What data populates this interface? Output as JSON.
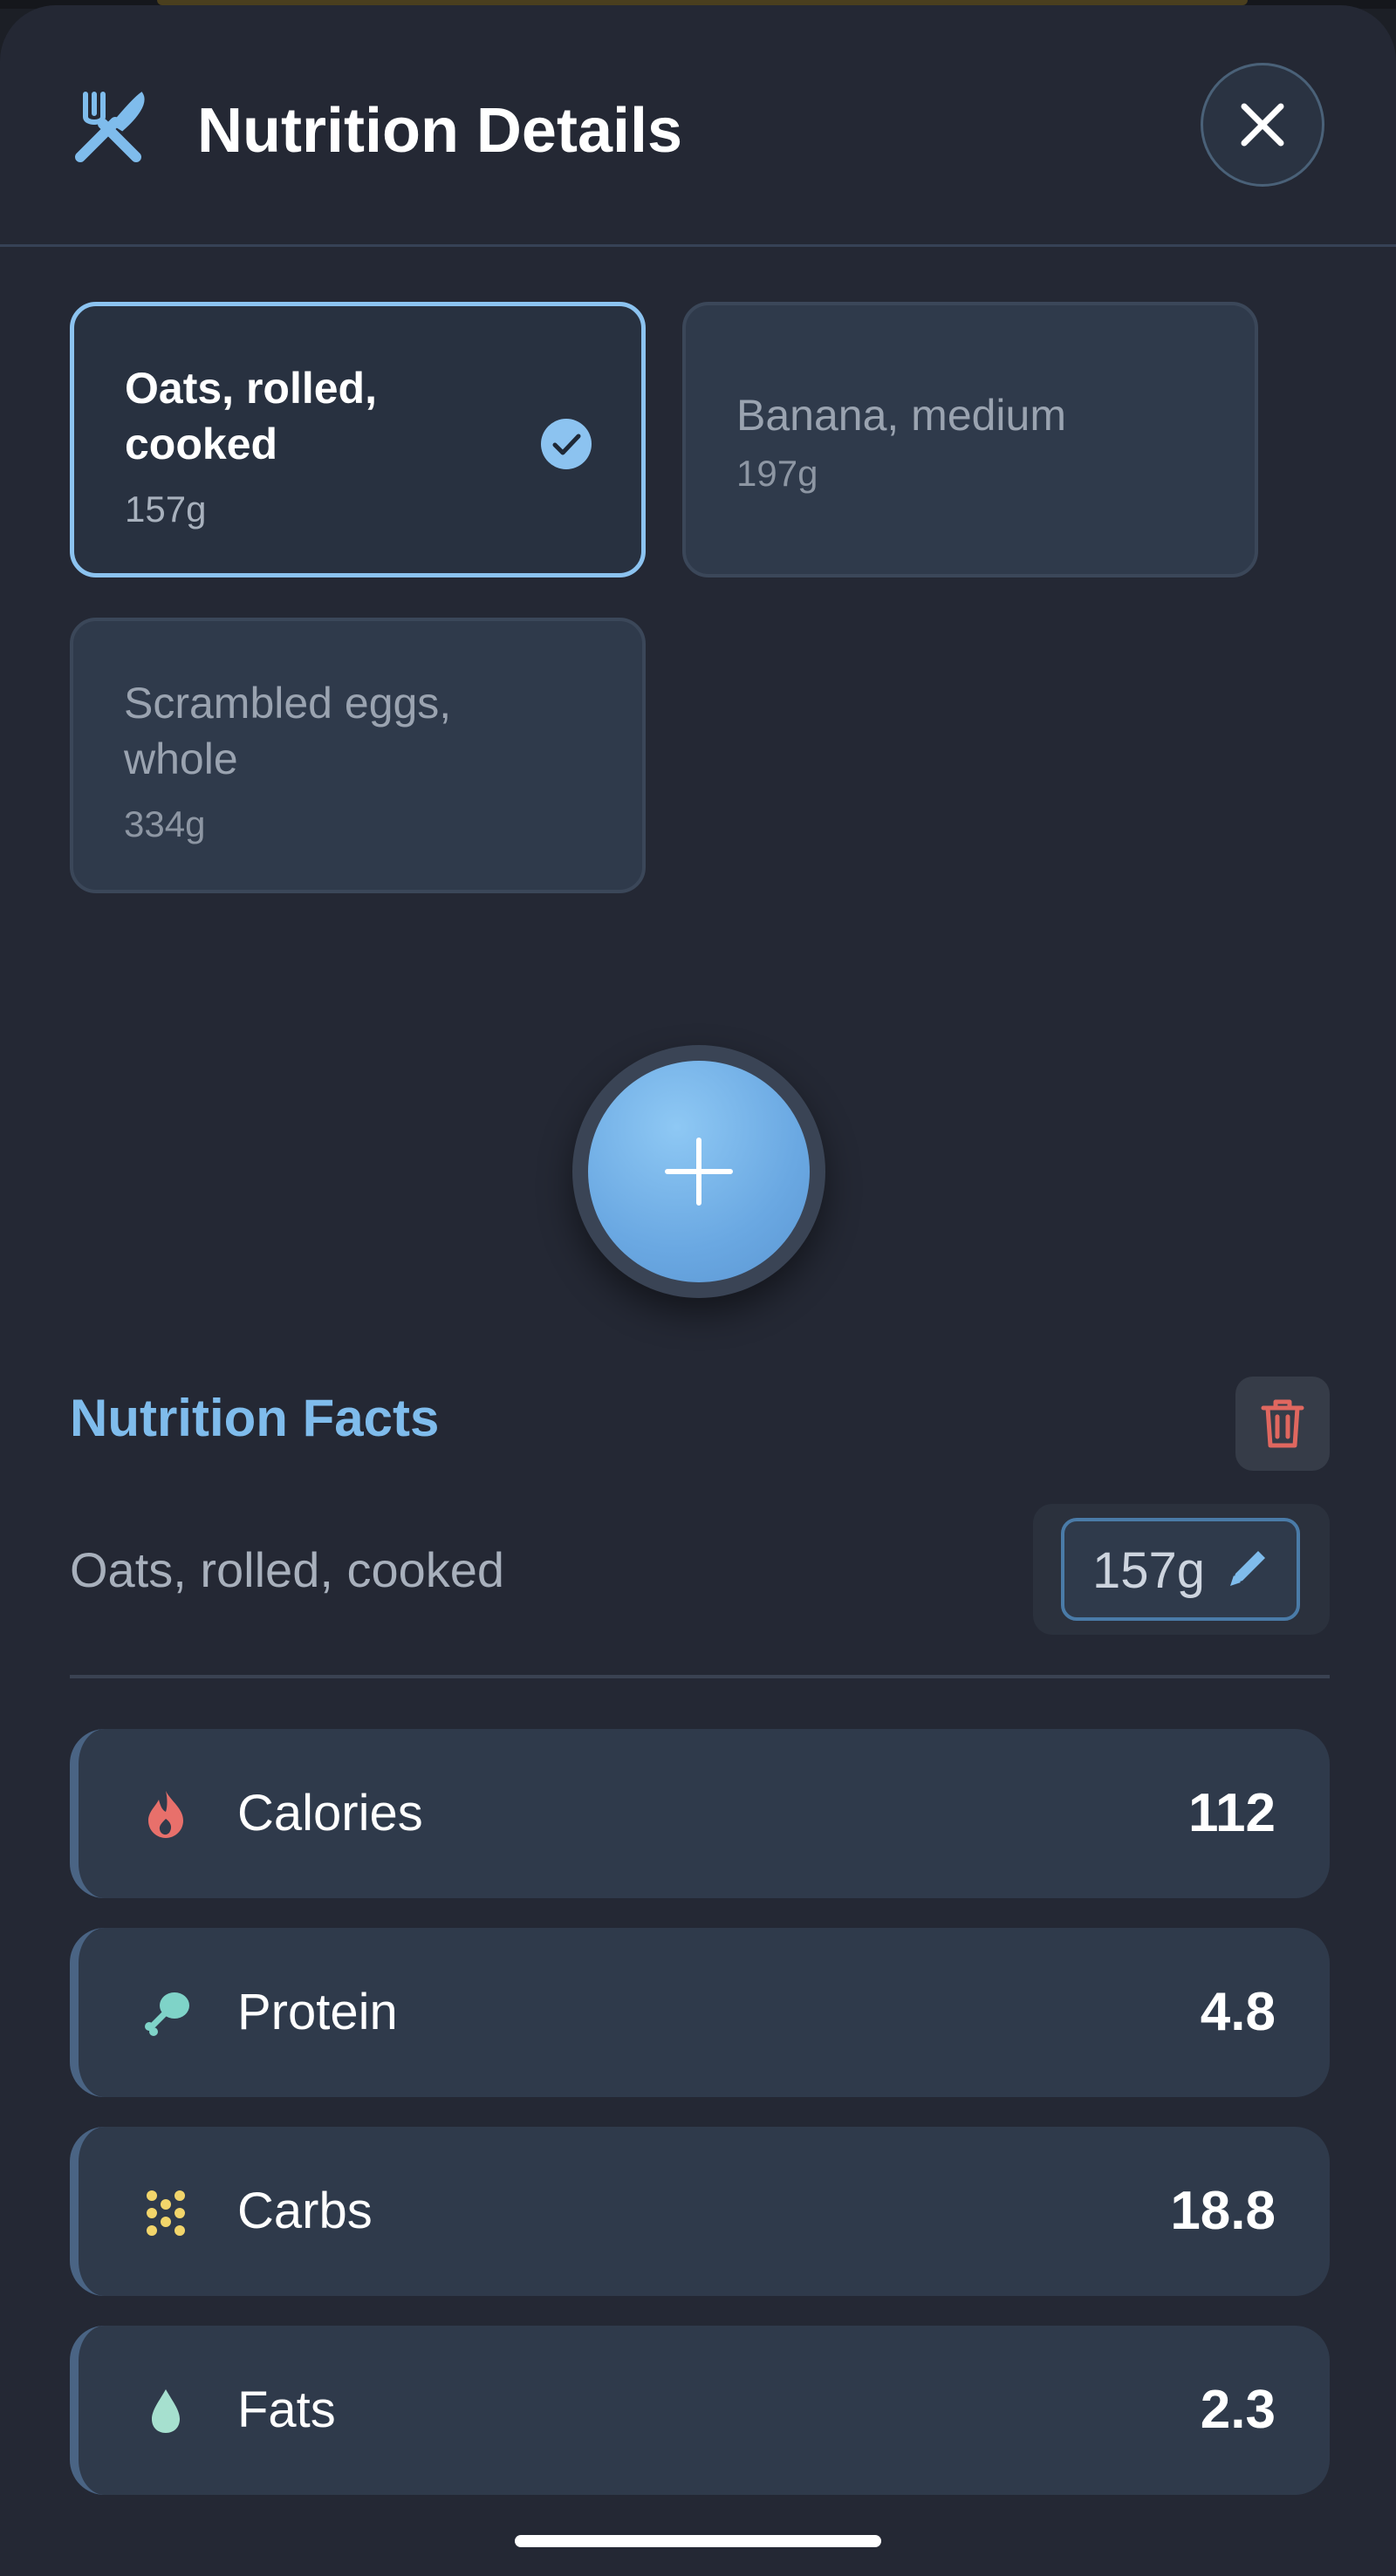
{
  "header": {
    "title": "Nutrition Details",
    "logo_icon": "fork-knife-icon",
    "close_icon": "close-icon"
  },
  "foods": [
    {
      "name": "Oats, rolled, cooked",
      "weight": "157g",
      "selected": true
    },
    {
      "name": "Banana, medium",
      "weight": "197g",
      "selected": false
    },
    {
      "name": "Scrambled eggs, whole",
      "weight": "334g",
      "selected": false
    }
  ],
  "add_button": {
    "icon": "plus-icon"
  },
  "facts": {
    "title": "Nutrition Facts",
    "delete_icon": "trash-icon",
    "food_name": "Oats, rolled, cooked",
    "weight": "157g",
    "edit_icon": "pencil-icon",
    "rows": [
      {
        "label": "Calories",
        "value": "112",
        "icon": "flame-icon",
        "color": "#e8706b"
      },
      {
        "label": "Protein",
        "value": "4.8",
        "icon": "drumstick-icon",
        "color": "#7fd3c8"
      },
      {
        "label": "Carbs",
        "value": "18.8",
        "icon": "grain-icon",
        "color": "#f2d56b"
      },
      {
        "label": "Fats",
        "value": "2.3",
        "icon": "droplet-icon",
        "color": "#a6e0cf"
      }
    ]
  },
  "colors": {
    "accent": "#7fbcec",
    "selected_border": "#8cc3f0",
    "delete": "#e0675f",
    "sheet_bg": "#242834"
  }
}
